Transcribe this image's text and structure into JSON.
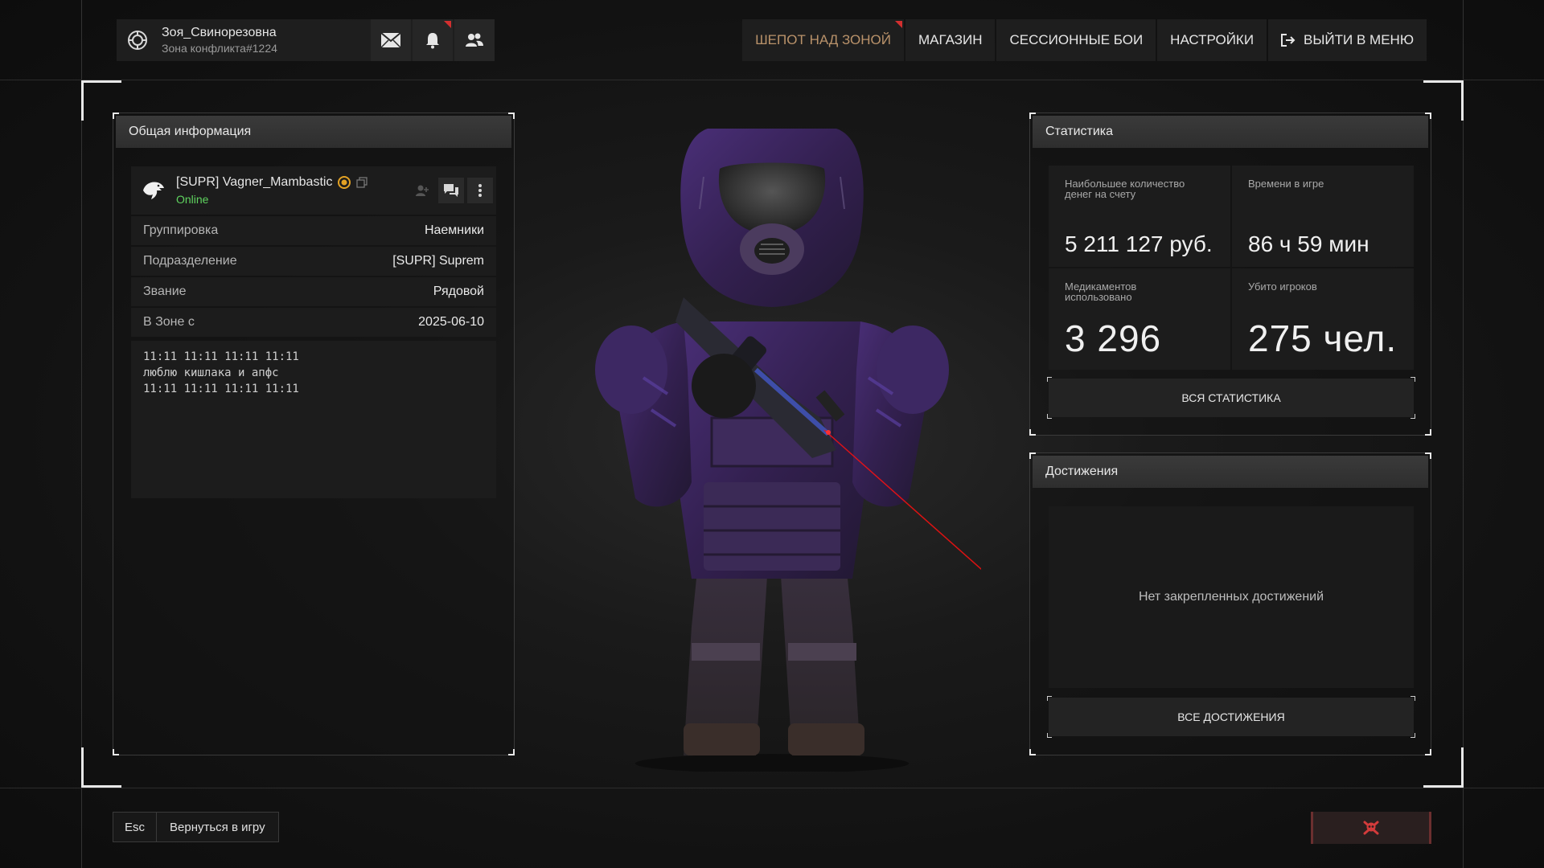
{
  "profile": {
    "name": "Зоя_Свинорезовна",
    "subtitle": "Зона конфликта#1224",
    "emblem_icon": "faction-emblem-icon",
    "buttons": [
      "mail-icon",
      "bell-icon",
      "friends-icon"
    ]
  },
  "nav": {
    "items": [
      {
        "label": "ШЕПОТ НАД ЗОНОЙ",
        "active": true
      },
      {
        "label": "МАГАЗИН"
      },
      {
        "label": "СЕССИОННЫЕ БОИ"
      },
      {
        "label": "НАСТРОЙКИ"
      },
      {
        "label": "ВЫЙТИ В МЕНЮ",
        "icon": "exit-icon"
      }
    ],
    "accent_color": "#b9926a"
  },
  "general": {
    "title": "Общая информация",
    "player": {
      "name": "[SUPR] Vagner_Mambastic",
      "status": "Online",
      "status_color": "#5fd35f"
    },
    "rows": [
      {
        "label": "Группировка",
        "value": "Наемники"
      },
      {
        "label": "Подразделение",
        "value": "[SUPR] Suprem"
      },
      {
        "label": "Звание",
        "value": "Рядовой"
      },
      {
        "label": "В Зоне с",
        "value": "2025-06-10"
      }
    ],
    "bio": [
      "11:11 11:11 11:11 11:11",
      "люблю кишлака и апфс",
      "11:11 11:11 11:11 11:11"
    ]
  },
  "stats": {
    "title": "Статистика",
    "cells": [
      {
        "label": "Наибольшее количество\nденег на счету",
        "value": "5 211 127 руб."
      },
      {
        "label": "Времени в игре",
        "value": "86 ч 59 мин"
      },
      {
        "label": "Медикаментов\nиспользовано",
        "value": "3 296"
      },
      {
        "label": "Убито игроков",
        "value": "275 чел."
      }
    ],
    "button": "ВСЯ СТАТИСТИКА"
  },
  "achievements": {
    "title": "Достижения",
    "empty": "Нет закрепленных достижений",
    "button": "ВСЕ ДОСТИЖЕНИЯ"
  },
  "bottom": {
    "esc_key": "Esc",
    "esc_label": "Вернуться в игру",
    "report_icon": "skull-icon"
  }
}
